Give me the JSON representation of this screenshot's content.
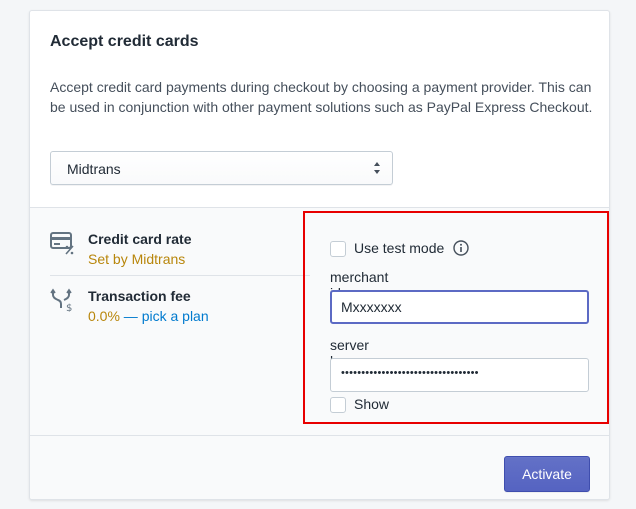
{
  "card": {
    "title": "Accept credit cards",
    "description": "Accept credit card payments during checkout by choosing a payment provider. This can be used in conjunction with other payment solutions such as PayPal Express Checkout.",
    "provider_select": {
      "value": "Midtrans"
    }
  },
  "features": [
    {
      "title": "Credit card rate",
      "subtitle": "Set by Midtrans",
      "icon": "credit-card-percent-icon"
    },
    {
      "title": "Transaction fee",
      "rate": "0.0%",
      "separator": " — ",
      "link": "pick a plan",
      "icon": "transaction-fork-icon"
    }
  ],
  "form": {
    "test_mode_label": "Use test mode",
    "merchant_id_label": "merchant id",
    "merchant_id_value": "Mxxxxxxx",
    "server_key_label": "server key",
    "server_key_value": "••••••••••••••••••••••••••••••••••",
    "show_label": "Show"
  },
  "actions": {
    "activate_label": "Activate"
  },
  "colors": {
    "accent": "#5c6ac4",
    "link": "#007ace",
    "gold": "#b8860b",
    "highlight_border": "#e80000"
  }
}
